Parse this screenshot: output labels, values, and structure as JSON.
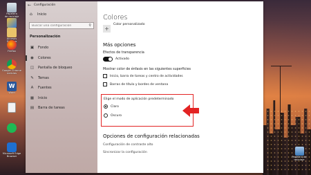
{
  "desktop": {
    "icons": [
      {
        "label": "Papelera\nde reciclaje",
        "name": "recycle-bin-icon"
      },
      {
        "label": "Paint",
        "name": "paint-icon"
      },
      {
        "label": "Accesos Directos",
        "name": "shortcuts-folder-icon"
      },
      {
        "label": "Firefox",
        "name": "firefox-icon"
      },
      {
        "label": "Google Chrome\nnoticias",
        "name": "chrome-icon"
      },
      {
        "label": "Word",
        "name": "word-icon"
      },
      {
        "label": "",
        "name": "document-icon"
      },
      {
        "label": "",
        "name": "spotify-icon"
      },
      {
        "label": "Microsoft Edge\nBrowser",
        "name": "edge-icon"
      }
    ],
    "right_icon_label": "Papelera de\nreciclaje"
  },
  "window": {
    "app_title": "Configuración",
    "home_label": "Inicio",
    "search_placeholder": "Buscar una configuración",
    "section_title": "Personalización",
    "nav_items": [
      {
        "label": "Fondo",
        "icon": "image-icon"
      },
      {
        "label": "Colores",
        "icon": "palette-icon"
      },
      {
        "label": "Pantalla de bloqueo",
        "icon": "lock-screen-icon"
      },
      {
        "label": "Temas",
        "icon": "brush-icon"
      },
      {
        "label": "Fuentes",
        "icon": "font-icon"
      },
      {
        "label": "Inicio",
        "icon": "start-icon"
      },
      {
        "label": "Barra de tareas",
        "icon": "taskbar-icon"
      }
    ],
    "active_nav": "Colores"
  },
  "content": {
    "page_title": "Colores",
    "custom_color_label": "Color personalizado",
    "more_options": "Más opciones",
    "transparency_label": "Efectos de transparencia",
    "transparency_state": "Activado",
    "accent_surfaces_label": "Mostrar color de énfasis en las siguientes superficies",
    "check_start": "Inicio, barra de tareas y centro de actividades",
    "check_titlebars": "Barras de título y bordes de ventana",
    "app_mode_label": "Elige el modo de aplicación predeterminado",
    "mode_light": "Claro",
    "mode_dark": "Oscuro",
    "selected_mode": "Claro",
    "related_title": "Opciones de configuración relacionadas",
    "link_contrast": "Configuración de contraste alto",
    "link_sync": "Sincronizar la configuración"
  },
  "colors": {
    "highlight": "#e32323",
    "arrow": "#e32323"
  }
}
